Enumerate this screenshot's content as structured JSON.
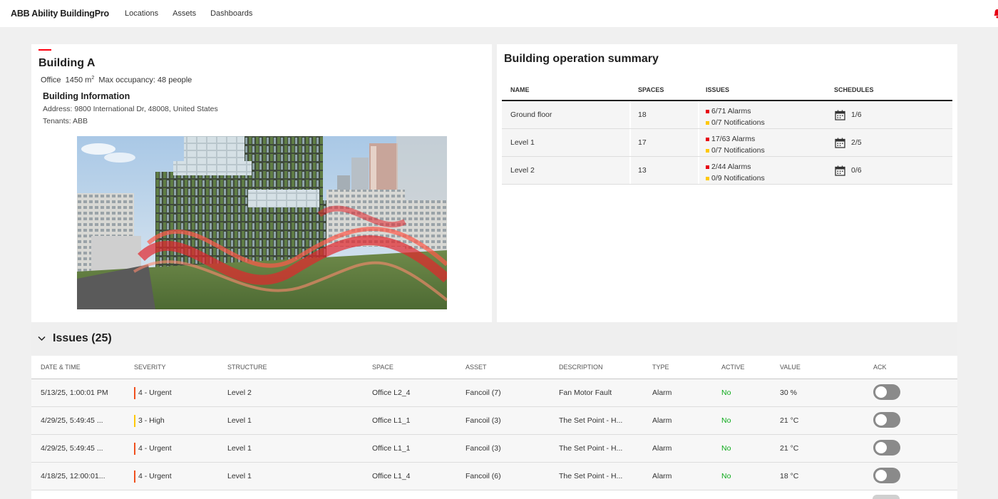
{
  "app": {
    "brand": "ABB Ability BuildingPro",
    "nav": [
      "Locations",
      "Assets",
      "Dashboards"
    ]
  },
  "building": {
    "title": "Building A",
    "type": "Office",
    "area": "1450 m",
    "area_exp": "2",
    "occupancy": "Max occupancy: 48 people",
    "info_title": "Building Information",
    "address": "Address: 9800 International Dr, 48008, United States",
    "tenants": "Tenants: ABB"
  },
  "summary": {
    "title": "Building operation summary",
    "columns": [
      "NAME",
      "SPACES",
      "ISSUES",
      "SCHEDULES"
    ],
    "rows": [
      {
        "name": "Ground floor",
        "spaces": "18",
        "alarms": "6/71 Alarms",
        "notifications": "0/7 Notifications",
        "schedules": "1/6"
      },
      {
        "name": "Level 1",
        "spaces": "17",
        "alarms": "17/63 Alarms",
        "notifications": "0/7 Notifications",
        "schedules": "2/5"
      },
      {
        "name": "Level 2",
        "spaces": "13",
        "alarms": "2/44 Alarms",
        "notifications": "0/9 Notifications",
        "schedules": "0/6"
      }
    ]
  },
  "issues": {
    "title": "Issues (25)",
    "columns": [
      "DATE & TIME",
      "SEVERITY",
      "STRUCTURE",
      "SPACE",
      "ASSET",
      "DESCRIPTION",
      "TYPE",
      "ACTIVE",
      "VALUE",
      "ACK"
    ],
    "rows": [
      {
        "datetime": "5/13/25, 1:00:01 PM",
        "severity": "4 - Urgent",
        "structure": "Level 2",
        "space": "Office L2_4",
        "asset": "Fancoil (7)",
        "description": "Fan Motor Fault",
        "type": "Alarm",
        "active": "No",
        "value": "30 %"
      },
      {
        "datetime": "4/29/25, 5:49:45 ...",
        "severity": "3 - High",
        "structure": "Level 1",
        "space": "Office L1_1",
        "asset": "Fancoil (3)",
        "description": "The Set Point - H...",
        "type": "Alarm",
        "active": "No",
        "value": "21 °C"
      },
      {
        "datetime": "4/29/25, 5:49:45 ...",
        "severity": "4 - Urgent",
        "structure": "Level 1",
        "space": "Office L1_1",
        "asset": "Fancoil (3)",
        "description": "The Set Point - H...",
        "type": "Alarm",
        "active": "No",
        "value": "21 °C"
      },
      {
        "datetime": "4/18/25, 12:00:01...",
        "severity": "4 - Urgent",
        "structure": "Level 1",
        "space": "Office L1_4",
        "asset": "Fancoil (6)",
        "description": "The Set Point - H...",
        "type": "Alarm",
        "active": "No",
        "value": "18 °C"
      }
    ]
  },
  "colors": {
    "accent": "#ff000f",
    "alarm": "#e60012",
    "notification": "#ffc800",
    "urgent": "#f0501e",
    "high": "#ffc800",
    "active_no": "#0ca919"
  },
  "icons": [
    "notification-bell-icon",
    "calendar-icon",
    "chevron-down-icon",
    "alarm-dot-icon",
    "notification-dot-icon"
  ]
}
